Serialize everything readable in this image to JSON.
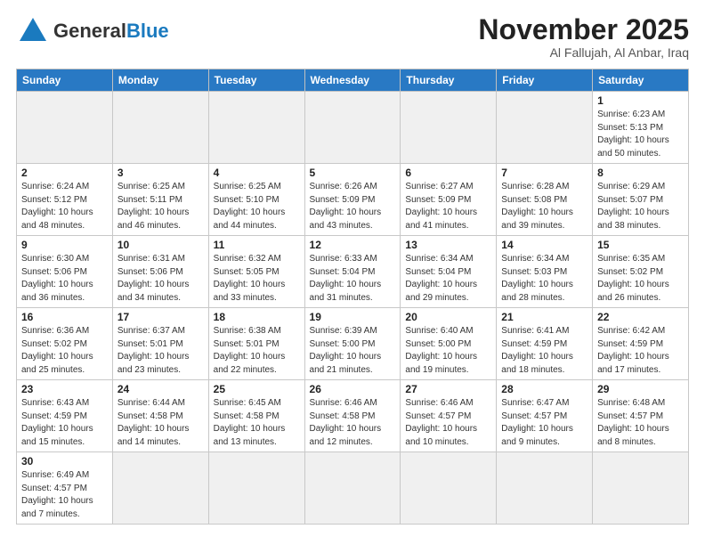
{
  "logo": {
    "text_general": "General",
    "text_blue": "Blue"
  },
  "header": {
    "month_title": "November 2025",
    "location": "Al Fallujah, Al Anbar, Iraq"
  },
  "weekdays": [
    "Sunday",
    "Monday",
    "Tuesday",
    "Wednesday",
    "Thursday",
    "Friday",
    "Saturday"
  ],
  "weeks": [
    [
      {
        "day": "",
        "info": ""
      },
      {
        "day": "",
        "info": ""
      },
      {
        "day": "",
        "info": ""
      },
      {
        "day": "",
        "info": ""
      },
      {
        "day": "",
        "info": ""
      },
      {
        "day": "",
        "info": ""
      },
      {
        "day": "1",
        "info": "Sunrise: 6:23 AM\nSunset: 5:13 PM\nDaylight: 10 hours\nand 50 minutes."
      }
    ],
    [
      {
        "day": "2",
        "info": "Sunrise: 6:24 AM\nSunset: 5:12 PM\nDaylight: 10 hours\nand 48 minutes."
      },
      {
        "day": "3",
        "info": "Sunrise: 6:25 AM\nSunset: 5:11 PM\nDaylight: 10 hours\nand 46 minutes."
      },
      {
        "day": "4",
        "info": "Sunrise: 6:25 AM\nSunset: 5:10 PM\nDaylight: 10 hours\nand 44 minutes."
      },
      {
        "day": "5",
        "info": "Sunrise: 6:26 AM\nSunset: 5:09 PM\nDaylight: 10 hours\nand 43 minutes."
      },
      {
        "day": "6",
        "info": "Sunrise: 6:27 AM\nSunset: 5:09 PM\nDaylight: 10 hours\nand 41 minutes."
      },
      {
        "day": "7",
        "info": "Sunrise: 6:28 AM\nSunset: 5:08 PM\nDaylight: 10 hours\nand 39 minutes."
      },
      {
        "day": "8",
        "info": "Sunrise: 6:29 AM\nSunset: 5:07 PM\nDaylight: 10 hours\nand 38 minutes."
      }
    ],
    [
      {
        "day": "9",
        "info": "Sunrise: 6:30 AM\nSunset: 5:06 PM\nDaylight: 10 hours\nand 36 minutes."
      },
      {
        "day": "10",
        "info": "Sunrise: 6:31 AM\nSunset: 5:06 PM\nDaylight: 10 hours\nand 34 minutes."
      },
      {
        "day": "11",
        "info": "Sunrise: 6:32 AM\nSunset: 5:05 PM\nDaylight: 10 hours\nand 33 minutes."
      },
      {
        "day": "12",
        "info": "Sunrise: 6:33 AM\nSunset: 5:04 PM\nDaylight: 10 hours\nand 31 minutes."
      },
      {
        "day": "13",
        "info": "Sunrise: 6:34 AM\nSunset: 5:04 PM\nDaylight: 10 hours\nand 29 minutes."
      },
      {
        "day": "14",
        "info": "Sunrise: 6:34 AM\nSunset: 5:03 PM\nDaylight: 10 hours\nand 28 minutes."
      },
      {
        "day": "15",
        "info": "Sunrise: 6:35 AM\nSunset: 5:02 PM\nDaylight: 10 hours\nand 26 minutes."
      }
    ],
    [
      {
        "day": "16",
        "info": "Sunrise: 6:36 AM\nSunset: 5:02 PM\nDaylight: 10 hours\nand 25 minutes."
      },
      {
        "day": "17",
        "info": "Sunrise: 6:37 AM\nSunset: 5:01 PM\nDaylight: 10 hours\nand 23 minutes."
      },
      {
        "day": "18",
        "info": "Sunrise: 6:38 AM\nSunset: 5:01 PM\nDaylight: 10 hours\nand 22 minutes."
      },
      {
        "day": "19",
        "info": "Sunrise: 6:39 AM\nSunset: 5:00 PM\nDaylight: 10 hours\nand 21 minutes."
      },
      {
        "day": "20",
        "info": "Sunrise: 6:40 AM\nSunset: 5:00 PM\nDaylight: 10 hours\nand 19 minutes."
      },
      {
        "day": "21",
        "info": "Sunrise: 6:41 AM\nSunset: 4:59 PM\nDaylight: 10 hours\nand 18 minutes."
      },
      {
        "day": "22",
        "info": "Sunrise: 6:42 AM\nSunset: 4:59 PM\nDaylight: 10 hours\nand 17 minutes."
      }
    ],
    [
      {
        "day": "23",
        "info": "Sunrise: 6:43 AM\nSunset: 4:59 PM\nDaylight: 10 hours\nand 15 minutes."
      },
      {
        "day": "24",
        "info": "Sunrise: 6:44 AM\nSunset: 4:58 PM\nDaylight: 10 hours\nand 14 minutes."
      },
      {
        "day": "25",
        "info": "Sunrise: 6:45 AM\nSunset: 4:58 PM\nDaylight: 10 hours\nand 13 minutes."
      },
      {
        "day": "26",
        "info": "Sunrise: 6:46 AM\nSunset: 4:58 PM\nDaylight: 10 hours\nand 12 minutes."
      },
      {
        "day": "27",
        "info": "Sunrise: 6:46 AM\nSunset: 4:57 PM\nDaylight: 10 hours\nand 10 minutes."
      },
      {
        "day": "28",
        "info": "Sunrise: 6:47 AM\nSunset: 4:57 PM\nDaylight: 10 hours\nand 9 minutes."
      },
      {
        "day": "29",
        "info": "Sunrise: 6:48 AM\nSunset: 4:57 PM\nDaylight: 10 hours\nand 8 minutes."
      }
    ],
    [
      {
        "day": "30",
        "info": "Sunrise: 6:49 AM\nSunset: 4:57 PM\nDaylight: 10 hours\nand 7 minutes."
      },
      {
        "day": "",
        "info": ""
      },
      {
        "day": "",
        "info": ""
      },
      {
        "day": "",
        "info": ""
      },
      {
        "day": "",
        "info": ""
      },
      {
        "day": "",
        "info": ""
      },
      {
        "day": "",
        "info": ""
      }
    ]
  ]
}
